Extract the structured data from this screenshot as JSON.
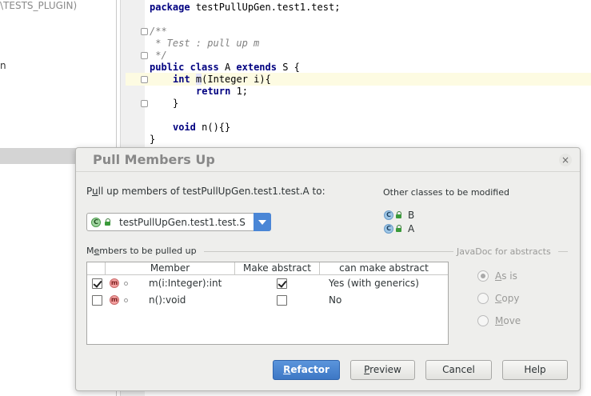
{
  "project_tree": {
    "header_text": "\\TESTS_PLUGIN)",
    "partial_item": "n"
  },
  "editor": {
    "lines": {
      "package_kw": "package",
      "package_name": " testPullUpGen.test1.test;",
      "comment_open": "/**",
      "comment_body": " * Test : pull up m",
      "comment_close": " */",
      "class_public": "public",
      "class_kw": "class",
      "class_name": " A ",
      "extends_kw": "extends",
      "class_rest": " S {",
      "method_type": "int",
      "method_name": "m",
      "method_rest": "(Integer i){",
      "return_kw": "return",
      "return_rest": " 1;",
      "close_method": "}",
      "void_kw": "void",
      "void_rest": " n(){}",
      "close_class": "}"
    }
  },
  "dialog": {
    "title": "Pull Members Up",
    "close_symbol": "×",
    "pull_up_label_u": "u",
    "pull_up_label_pre": "P",
    "pull_up_label_post": "ll up members of testPullUpGen.test1.test.A to:",
    "target_combo_value": "testPullUpGen.test1.test.S",
    "other_classes_label": "Other classes to be modified",
    "other_classes": [
      {
        "icon_letter": "C",
        "name": "B"
      },
      {
        "icon_letter": "C",
        "name": "A"
      }
    ],
    "members_label_pre": "M",
    "members_label_u": "e",
    "members_label_post": "mbers to be pulled up",
    "javadoc_label": "JavaDoc for abstracts",
    "table": {
      "columns": [
        "Member",
        "Make abstract",
        "can make abstract"
      ],
      "rows": [
        {
          "checked": true,
          "icon_letter": "m",
          "member": "m(i:Integer):int",
          "make_abstract": true,
          "can_make_abstract": "Yes (with generics)"
        },
        {
          "checked": false,
          "icon_letter": "m",
          "member": "n():void",
          "make_abstract": false,
          "can_make_abstract": "No"
        }
      ]
    },
    "javadoc_options": [
      {
        "u": "A",
        "rest": "s is",
        "selected": true
      },
      {
        "u": "C",
        "rest": "opy",
        "selected": false
      },
      {
        "u": "M",
        "rest": "ove",
        "selected": false
      }
    ],
    "buttons": {
      "refactor_u": "R",
      "refactor_rest": "efactor",
      "preview_u": "P",
      "preview_rest": "review",
      "cancel": "Cancel",
      "help": "Help"
    }
  },
  "colors": {
    "primary_button": "#3d77c5",
    "dialog_bg": "#eeeeec",
    "current_line": "#fdfbe2"
  }
}
